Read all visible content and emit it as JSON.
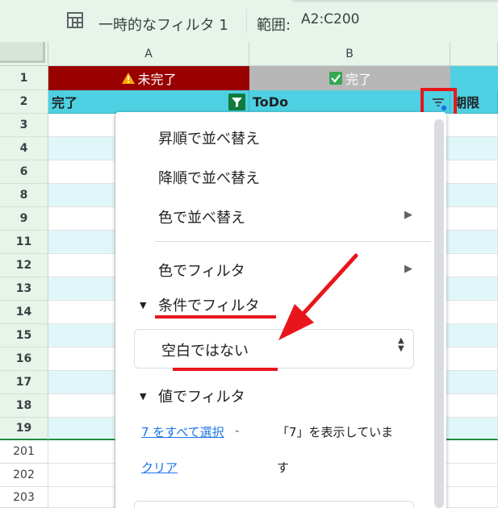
{
  "toolbar": {
    "filter_view_icon": "filter-view-icon",
    "filter_name": "一時的なフィルタ 1",
    "range_label": "範囲:",
    "range_value": "A2:C200"
  },
  "columns": [
    {
      "label": "A"
    },
    {
      "label": "B"
    }
  ],
  "rows": [
    "1",
    "2",
    "3",
    "4",
    "6",
    "8",
    "9",
    "11",
    "12",
    "13",
    "14",
    "15",
    "16",
    "17",
    "18",
    "19",
    "201",
    "202",
    "203"
  ],
  "status_row": {
    "a": {
      "icon": "warning-icon",
      "text": "未完了",
      "color": "#990000"
    },
    "b": {
      "icon": "check-box-icon",
      "text": "完了",
      "color": "#b7b7b7"
    }
  },
  "header_row": {
    "a": "完了",
    "b": "ToDo",
    "c": "期限"
  },
  "colors": {
    "header_cyan": "#4dd0e1",
    "band_light": "#e0f7fa",
    "annotation_red": "#e8161c",
    "link_blue": "#1a73e8"
  },
  "menu": {
    "sort_asc": "昇順で並べ替え",
    "sort_desc": "降順で並べ替え",
    "sort_by_color": "色で並べ替え",
    "filter_by_color": "色でフィルタ",
    "filter_by_condition": "条件でフィルタ",
    "condition_value": "空白ではない",
    "filter_by_values": "値でフィルタ",
    "select_all": "7 をすべて選択",
    "dash": "-",
    "clear": "クリア",
    "message_line1": "「7」を表示していま",
    "message_line2": "す"
  }
}
